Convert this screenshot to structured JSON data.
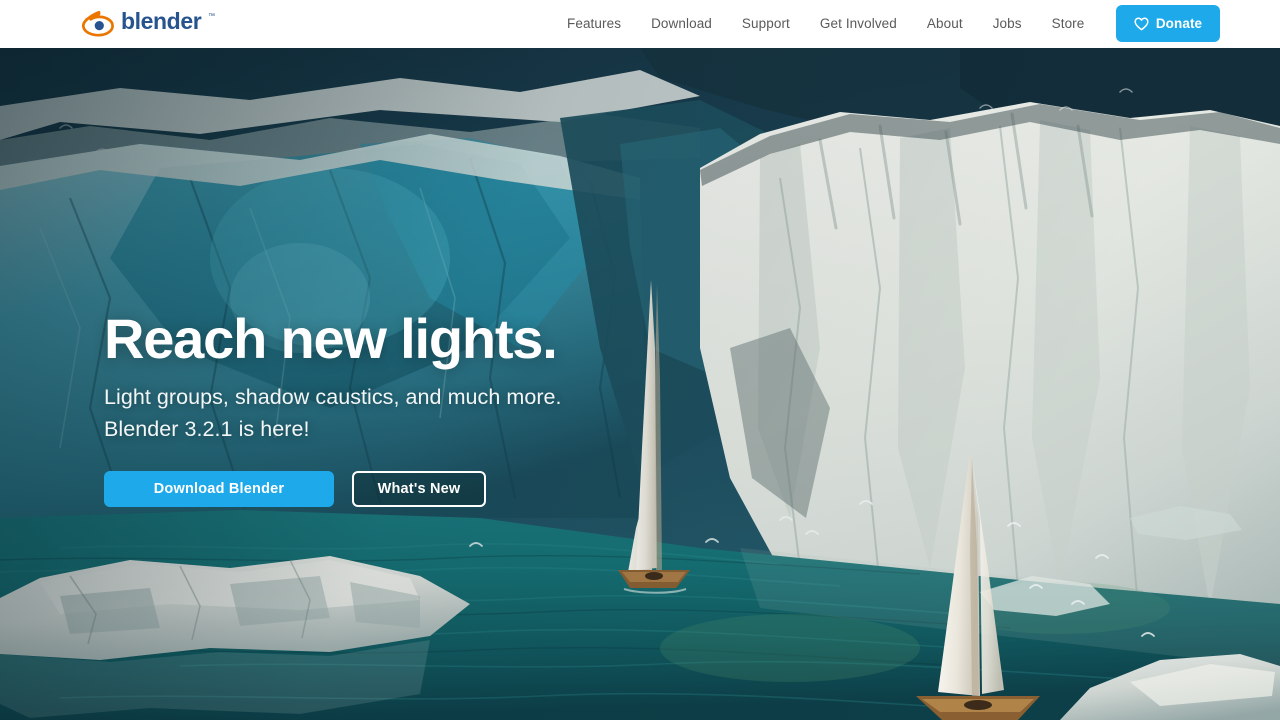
{
  "header": {
    "logo": {
      "name": "blender-logo",
      "wordmark": "blender",
      "trademark": "™",
      "mark_color": "#ea7600",
      "word_color": "#27548e"
    },
    "nav": [
      {
        "label": "Features",
        "name": "nav-link-features"
      },
      {
        "label": "Download",
        "name": "nav-link-download"
      },
      {
        "label": "Support",
        "name": "nav-link-support"
      },
      {
        "label": "Get Involved",
        "name": "nav-link-get-involved"
      },
      {
        "label": "About",
        "name": "nav-link-about"
      },
      {
        "label": "Jobs",
        "name": "nav-link-jobs"
      },
      {
        "label": "Store",
        "name": "nav-link-store"
      }
    ],
    "donate": {
      "label": "Donate",
      "icon": "heart-icon",
      "color": "#1eaaea"
    }
  },
  "hero": {
    "title": "Reach new lights.",
    "subtitle_line1": "Light groups, shadow caustics, and much more.",
    "subtitle_line2": "Blender 3.2.1 is here!",
    "primary_button": "Download Blender",
    "secondary_button": "What's New",
    "scene": {
      "description": "glacier lagoon with icebergs and two sailboats",
      "water_color": "#16646b",
      "ice_blue": "#63b4c4",
      "ice_white": "#e8ece6",
      "sky_dark": "#1c3d52"
    }
  },
  "theme": {
    "accent": "#1eaaea",
    "header_bg": "#ffffff",
    "nav_text": "#5a5a5a"
  }
}
